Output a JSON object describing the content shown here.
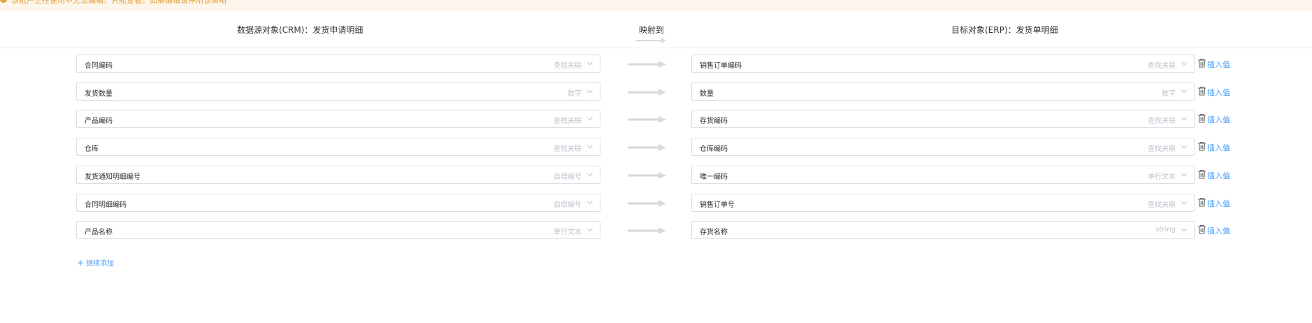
{
  "warning": {
    "text": "该租户正在使用中无法编辑，只能查看。如需编辑请停用该策略"
  },
  "header": {
    "source_title": "数据源对象(CRM)：发货申请明细",
    "mapping_title": "映射到",
    "target_title": "目标对象(ERP)：发货单明细"
  },
  "rows": [
    {
      "source_name": "合同编码",
      "source_type": "查找关联",
      "target_name": "销售订单编码",
      "target_type": "查找关联"
    },
    {
      "source_name": "发货数量",
      "source_type": "数字",
      "target_name": "数量",
      "target_type": "数字"
    },
    {
      "source_name": "产品编码",
      "source_type": "查找关联",
      "target_name": "存货编码",
      "target_type": "查找关联"
    },
    {
      "source_name": "仓库",
      "source_type": "查找关联",
      "target_name": "仓库编码",
      "target_type": "查找关联"
    },
    {
      "source_name": "发货通知明细编号",
      "source_type": "自增编号",
      "target_name": "唯一编码",
      "target_type": "单行文本"
    },
    {
      "source_name": "合同明细编码",
      "source_type": "自增编号",
      "target_name": "销售订单号",
      "target_type": "查找关联"
    },
    {
      "source_name": "产品名称",
      "source_type": "单行文本",
      "target_name": "存货名称",
      "target_type": "string"
    }
  ],
  "row_actions": {
    "insert_label": "插入值",
    "delete_icon": "trash-icon"
  },
  "add_more": {
    "label": "继续添加"
  },
  "colors": {
    "warning": "#e6a23c",
    "warning_bg": "#fdf6ec",
    "link": "#409eff",
    "border": "#dcdfe6",
    "placeholder": "#c0c4cc"
  }
}
